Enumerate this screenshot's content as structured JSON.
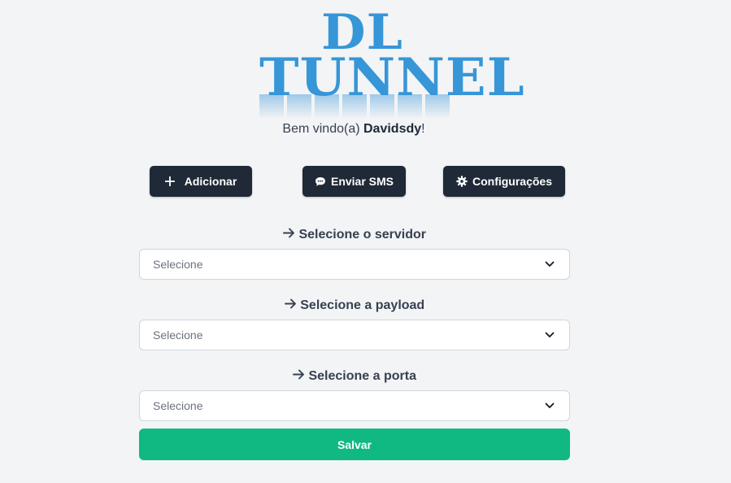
{
  "logo": {
    "line1": "DL",
    "line2": "TUNNEL"
  },
  "welcome": {
    "prefix": "Bem vindo(a) ",
    "username": "Davidsdy",
    "suffix": "!"
  },
  "actions": {
    "add_label": "Adicionar",
    "sms_label": "Enviar SMS",
    "settings_label": "Configurações"
  },
  "fields": [
    {
      "label": "Selecione o servidor",
      "value": "Selecione"
    },
    {
      "label": "Selecione a payload",
      "value": "Selecione"
    },
    {
      "label": "Selecione a porta",
      "value": "Selecione"
    }
  ],
  "save_label": "Salvar",
  "colors": {
    "logo": "#3696d7",
    "dark_button": "#1f2937",
    "save_button": "#10b981",
    "background": "#f3f4f6"
  },
  "icons": {
    "add": "plus-icon",
    "sms": "chat-bubble-icon",
    "settings": "gear-icon",
    "arrow": "arrow-right-icon",
    "dropdown": "chevron-down-icon"
  }
}
